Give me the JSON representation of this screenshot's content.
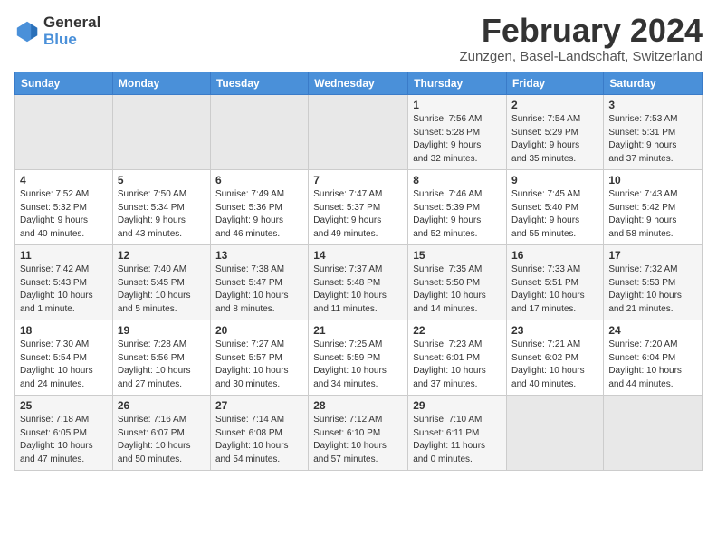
{
  "header": {
    "logo_general": "General",
    "logo_blue": "Blue",
    "month": "February 2024",
    "location": "Zunzgen, Basel-Landschaft, Switzerland"
  },
  "weekdays": [
    "Sunday",
    "Monday",
    "Tuesday",
    "Wednesday",
    "Thursday",
    "Friday",
    "Saturday"
  ],
  "weeks": [
    [
      {
        "day": "",
        "info": ""
      },
      {
        "day": "",
        "info": ""
      },
      {
        "day": "",
        "info": ""
      },
      {
        "day": "",
        "info": ""
      },
      {
        "day": "1",
        "info": "Sunrise: 7:56 AM\nSunset: 5:28 PM\nDaylight: 9 hours\nand 32 minutes."
      },
      {
        "day": "2",
        "info": "Sunrise: 7:54 AM\nSunset: 5:29 PM\nDaylight: 9 hours\nand 35 minutes."
      },
      {
        "day": "3",
        "info": "Sunrise: 7:53 AM\nSunset: 5:31 PM\nDaylight: 9 hours\nand 37 minutes."
      }
    ],
    [
      {
        "day": "4",
        "info": "Sunrise: 7:52 AM\nSunset: 5:32 PM\nDaylight: 9 hours\nand 40 minutes."
      },
      {
        "day": "5",
        "info": "Sunrise: 7:50 AM\nSunset: 5:34 PM\nDaylight: 9 hours\nand 43 minutes."
      },
      {
        "day": "6",
        "info": "Sunrise: 7:49 AM\nSunset: 5:36 PM\nDaylight: 9 hours\nand 46 minutes."
      },
      {
        "day": "7",
        "info": "Sunrise: 7:47 AM\nSunset: 5:37 PM\nDaylight: 9 hours\nand 49 minutes."
      },
      {
        "day": "8",
        "info": "Sunrise: 7:46 AM\nSunset: 5:39 PM\nDaylight: 9 hours\nand 52 minutes."
      },
      {
        "day": "9",
        "info": "Sunrise: 7:45 AM\nSunset: 5:40 PM\nDaylight: 9 hours\nand 55 minutes."
      },
      {
        "day": "10",
        "info": "Sunrise: 7:43 AM\nSunset: 5:42 PM\nDaylight: 9 hours\nand 58 minutes."
      }
    ],
    [
      {
        "day": "11",
        "info": "Sunrise: 7:42 AM\nSunset: 5:43 PM\nDaylight: 10 hours\nand 1 minute."
      },
      {
        "day": "12",
        "info": "Sunrise: 7:40 AM\nSunset: 5:45 PM\nDaylight: 10 hours\nand 5 minutes."
      },
      {
        "day": "13",
        "info": "Sunrise: 7:38 AM\nSunset: 5:47 PM\nDaylight: 10 hours\nand 8 minutes."
      },
      {
        "day": "14",
        "info": "Sunrise: 7:37 AM\nSunset: 5:48 PM\nDaylight: 10 hours\nand 11 minutes."
      },
      {
        "day": "15",
        "info": "Sunrise: 7:35 AM\nSunset: 5:50 PM\nDaylight: 10 hours\nand 14 minutes."
      },
      {
        "day": "16",
        "info": "Sunrise: 7:33 AM\nSunset: 5:51 PM\nDaylight: 10 hours\nand 17 minutes."
      },
      {
        "day": "17",
        "info": "Sunrise: 7:32 AM\nSunset: 5:53 PM\nDaylight: 10 hours\nand 21 minutes."
      }
    ],
    [
      {
        "day": "18",
        "info": "Sunrise: 7:30 AM\nSunset: 5:54 PM\nDaylight: 10 hours\nand 24 minutes."
      },
      {
        "day": "19",
        "info": "Sunrise: 7:28 AM\nSunset: 5:56 PM\nDaylight: 10 hours\nand 27 minutes."
      },
      {
        "day": "20",
        "info": "Sunrise: 7:27 AM\nSunset: 5:57 PM\nDaylight: 10 hours\nand 30 minutes."
      },
      {
        "day": "21",
        "info": "Sunrise: 7:25 AM\nSunset: 5:59 PM\nDaylight: 10 hours\nand 34 minutes."
      },
      {
        "day": "22",
        "info": "Sunrise: 7:23 AM\nSunset: 6:01 PM\nDaylight: 10 hours\nand 37 minutes."
      },
      {
        "day": "23",
        "info": "Sunrise: 7:21 AM\nSunset: 6:02 PM\nDaylight: 10 hours\nand 40 minutes."
      },
      {
        "day": "24",
        "info": "Sunrise: 7:20 AM\nSunset: 6:04 PM\nDaylight: 10 hours\nand 44 minutes."
      }
    ],
    [
      {
        "day": "25",
        "info": "Sunrise: 7:18 AM\nSunset: 6:05 PM\nDaylight: 10 hours\nand 47 minutes."
      },
      {
        "day": "26",
        "info": "Sunrise: 7:16 AM\nSunset: 6:07 PM\nDaylight: 10 hours\nand 50 minutes."
      },
      {
        "day": "27",
        "info": "Sunrise: 7:14 AM\nSunset: 6:08 PM\nDaylight: 10 hours\nand 54 minutes."
      },
      {
        "day": "28",
        "info": "Sunrise: 7:12 AM\nSunset: 6:10 PM\nDaylight: 10 hours\nand 57 minutes."
      },
      {
        "day": "29",
        "info": "Sunrise: 7:10 AM\nSunset: 6:11 PM\nDaylight: 11 hours\nand 0 minutes."
      },
      {
        "day": "",
        "info": ""
      },
      {
        "day": "",
        "info": ""
      }
    ]
  ]
}
